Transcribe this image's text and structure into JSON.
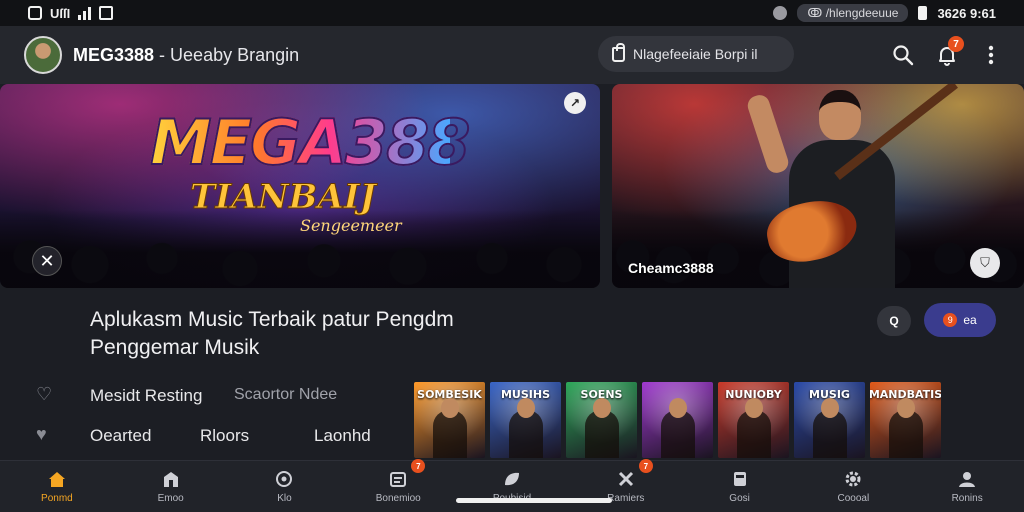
{
  "status_bar": {
    "left_text": "UſſI",
    "pill_text": "ↂ /hlengdeeuue",
    "time": "3626 9:61"
  },
  "header": {
    "app_name": "MEG3388",
    "subtitle": " - Ueeaby Brangin",
    "search_pill": "Nlagefeeiaie Borpi il",
    "notification_count": "7"
  },
  "banners": {
    "left": {
      "logo_title": "MEGA388",
      "logo_subtitle": "TIANBAIJ",
      "logo_tagline": "Sengeemeer"
    },
    "right": {
      "caption": "Cheamc3888"
    }
  },
  "content": {
    "headline": "Aplukasm Music Terbaik patur Pengdm Penggemar Musik",
    "chip_label": "Q",
    "pill_badge": "9",
    "pill_label": "ea",
    "rows": [
      {
        "col1": "Mesidt Resting",
        "col2": "Scaortor Ndee",
        "col3": ""
      },
      {
        "col1": "Oearted",
        "col2": "Rloors",
        "col3": "Laonhd"
      }
    ],
    "thumbnails": [
      {
        "title": "SOMBESIK",
        "color": "#ff9a2a"
      },
      {
        "title": "MUSIHS",
        "color": "#3a66c8"
      },
      {
        "title": "SOENS",
        "color": "#2ea85a"
      },
      {
        "title": "",
        "color": "#a03ad0"
      },
      {
        "title": "NUNIOBY",
        "color": "#c83a2a"
      },
      {
        "title": "MUSIG",
        "color": "#2a4aa8"
      },
      {
        "title": "MANDBATIS",
        "color": "#e05a1a"
      }
    ]
  },
  "bottom_nav": [
    {
      "label": "Ponmd",
      "icon": "home-icon",
      "active": true,
      "badge": ""
    },
    {
      "label": "Emoo",
      "icon": "store-icon",
      "active": false,
      "badge": ""
    },
    {
      "label": "Klo",
      "icon": "compass-icon",
      "active": false,
      "badge": ""
    },
    {
      "label": "Bonemioo",
      "icon": "calendar-icon",
      "active": false,
      "badge": "7"
    },
    {
      "label": "Poubisid",
      "icon": "leaf-icon",
      "active": false,
      "badge": ""
    },
    {
      "label": "Ramiers",
      "icon": "tools-icon",
      "active": false,
      "badge": "7"
    },
    {
      "label": "Gosi",
      "icon": "mailbox-icon",
      "active": false,
      "badge": ""
    },
    {
      "label": "Coooal",
      "icon": "gear-icon",
      "active": false,
      "badge": ""
    },
    {
      "label": "Ronins",
      "icon": "profile-icon",
      "active": false,
      "badge": ""
    }
  ],
  "colors": {
    "accent": "#f5a623",
    "badge": "#e8501e",
    "background": "#1c1e24",
    "header": "#25272d",
    "pill": "#3a3c8e"
  }
}
